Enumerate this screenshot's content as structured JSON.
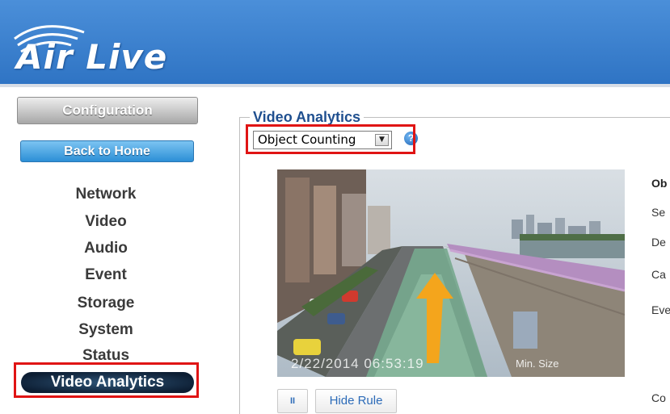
{
  "header": {
    "logo_text": "Air Live"
  },
  "sidebar": {
    "config_label": "Configuration",
    "home_label": "Back to Home",
    "items": [
      {
        "label": "Network"
      },
      {
        "label": "Video"
      },
      {
        "label": "Audio"
      },
      {
        "label": "Event"
      },
      {
        "label": "Storage"
      },
      {
        "label": "System"
      },
      {
        "label": "Status"
      }
    ],
    "active_item": "Video Analytics"
  },
  "main": {
    "section_title": "Video Analytics",
    "mode_select": {
      "value": "Object Counting"
    },
    "video": {
      "timestamp": "2/22/2014   06:53:19",
      "min_size_label": "Min. Size"
    },
    "controls": {
      "pause_label": "II",
      "hide_rule_label": "Hide Rule"
    },
    "side_labels": [
      "Ob",
      "Se",
      "De",
      "Ca",
      "Eve",
      "Co"
    ]
  }
}
